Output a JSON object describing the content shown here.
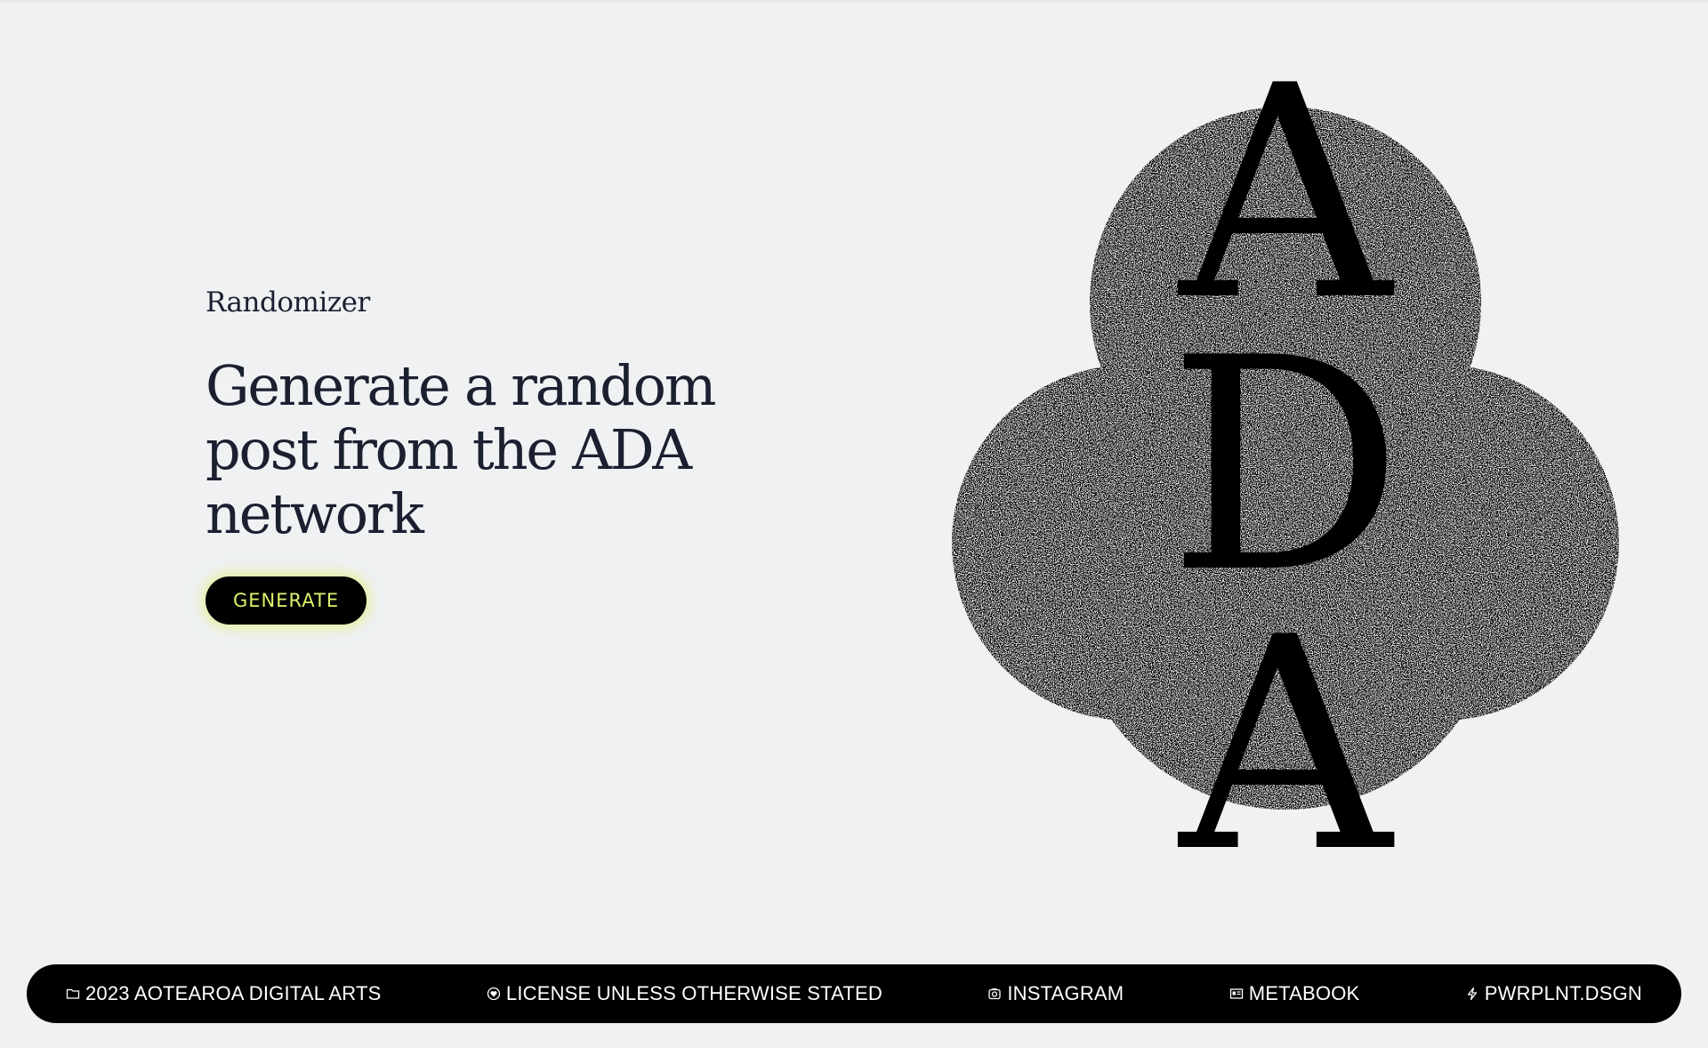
{
  "eyebrow": "Randomizer",
  "headline": {
    "line1": "Generate a random",
    "line2": "post from the ADA",
    "line3": "network"
  },
  "generate_button": {
    "label": "GENERATE"
  },
  "logo": {
    "letters": [
      "A",
      "D",
      "A"
    ],
    "icon": "ada-stacked-logo"
  },
  "footer": {
    "items": [
      {
        "label": "2023 AOTEAROA DIGITAL ARTS",
        "icon": "folder-icon"
      },
      {
        "label": "LICENSE UNLESS OTHERWISE STATED",
        "icon": "heart-badge-icon"
      },
      {
        "label": "INSTAGRAM",
        "icon": "camera-icon"
      },
      {
        "label": "METABOOK",
        "icon": "id-card-icon"
      },
      {
        "label": "PWRPLNT.DSGN",
        "icon": "bolt-icon"
      }
    ]
  },
  "colors": {
    "background": "#eff1f3",
    "text": "#1b2030",
    "button_bg": "#000000",
    "button_text": "#dff06a",
    "footer_bg": "#000000",
    "footer_text": "#ffffff"
  }
}
